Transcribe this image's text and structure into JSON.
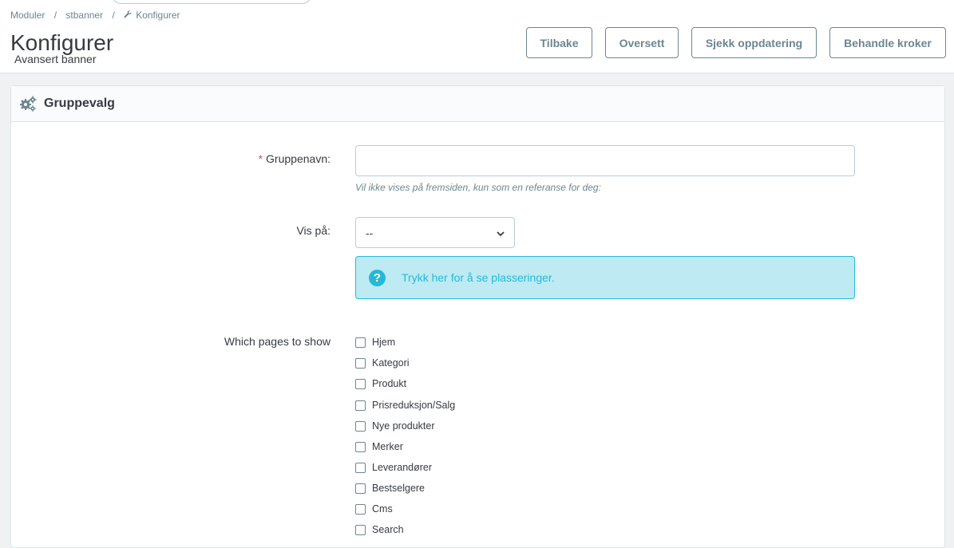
{
  "breadcrumb": {
    "item1": "Moduler",
    "item2": "stbanner",
    "item3": "Konfigurer",
    "separator": "/",
    "wrench_icon": "wrench-icon"
  },
  "header": {
    "title": "Konfigurer",
    "subtitle": "Avansert banner"
  },
  "toolbar": {
    "back": "Tilbake",
    "translate": "Oversett",
    "check_update": "Sjekk oppdatering",
    "manage_hooks": "Behandle kroker"
  },
  "panel": {
    "title": "Gruppevalg",
    "icon": "gears-icon"
  },
  "form": {
    "group_name": {
      "label": "Gruppenavn:",
      "required_mark": "*",
      "value": "",
      "help": "Vil ikke vises på fremsiden, kun som en referanse for deg:"
    },
    "show_on": {
      "label": "Vis på:",
      "selected": "--",
      "chevron": "⌄"
    },
    "alert": {
      "icon": "question-circle-icon",
      "glyph": "?",
      "text": "Trykk her for å se plasseringer."
    },
    "pages": {
      "label": "Which pages to show",
      "options": [
        "Hjem",
        "Kategori",
        "Produkt",
        "Prisreduksjon/Salg",
        "Nye produkter",
        "Merker",
        "Leverandører",
        "Bestselgere",
        "Cms",
        "Search"
      ]
    }
  },
  "colors": {
    "accent": "#25b9d7",
    "alert_bg": "#beeaf3",
    "required": "#c05c67",
    "muted": "#6c868e"
  }
}
